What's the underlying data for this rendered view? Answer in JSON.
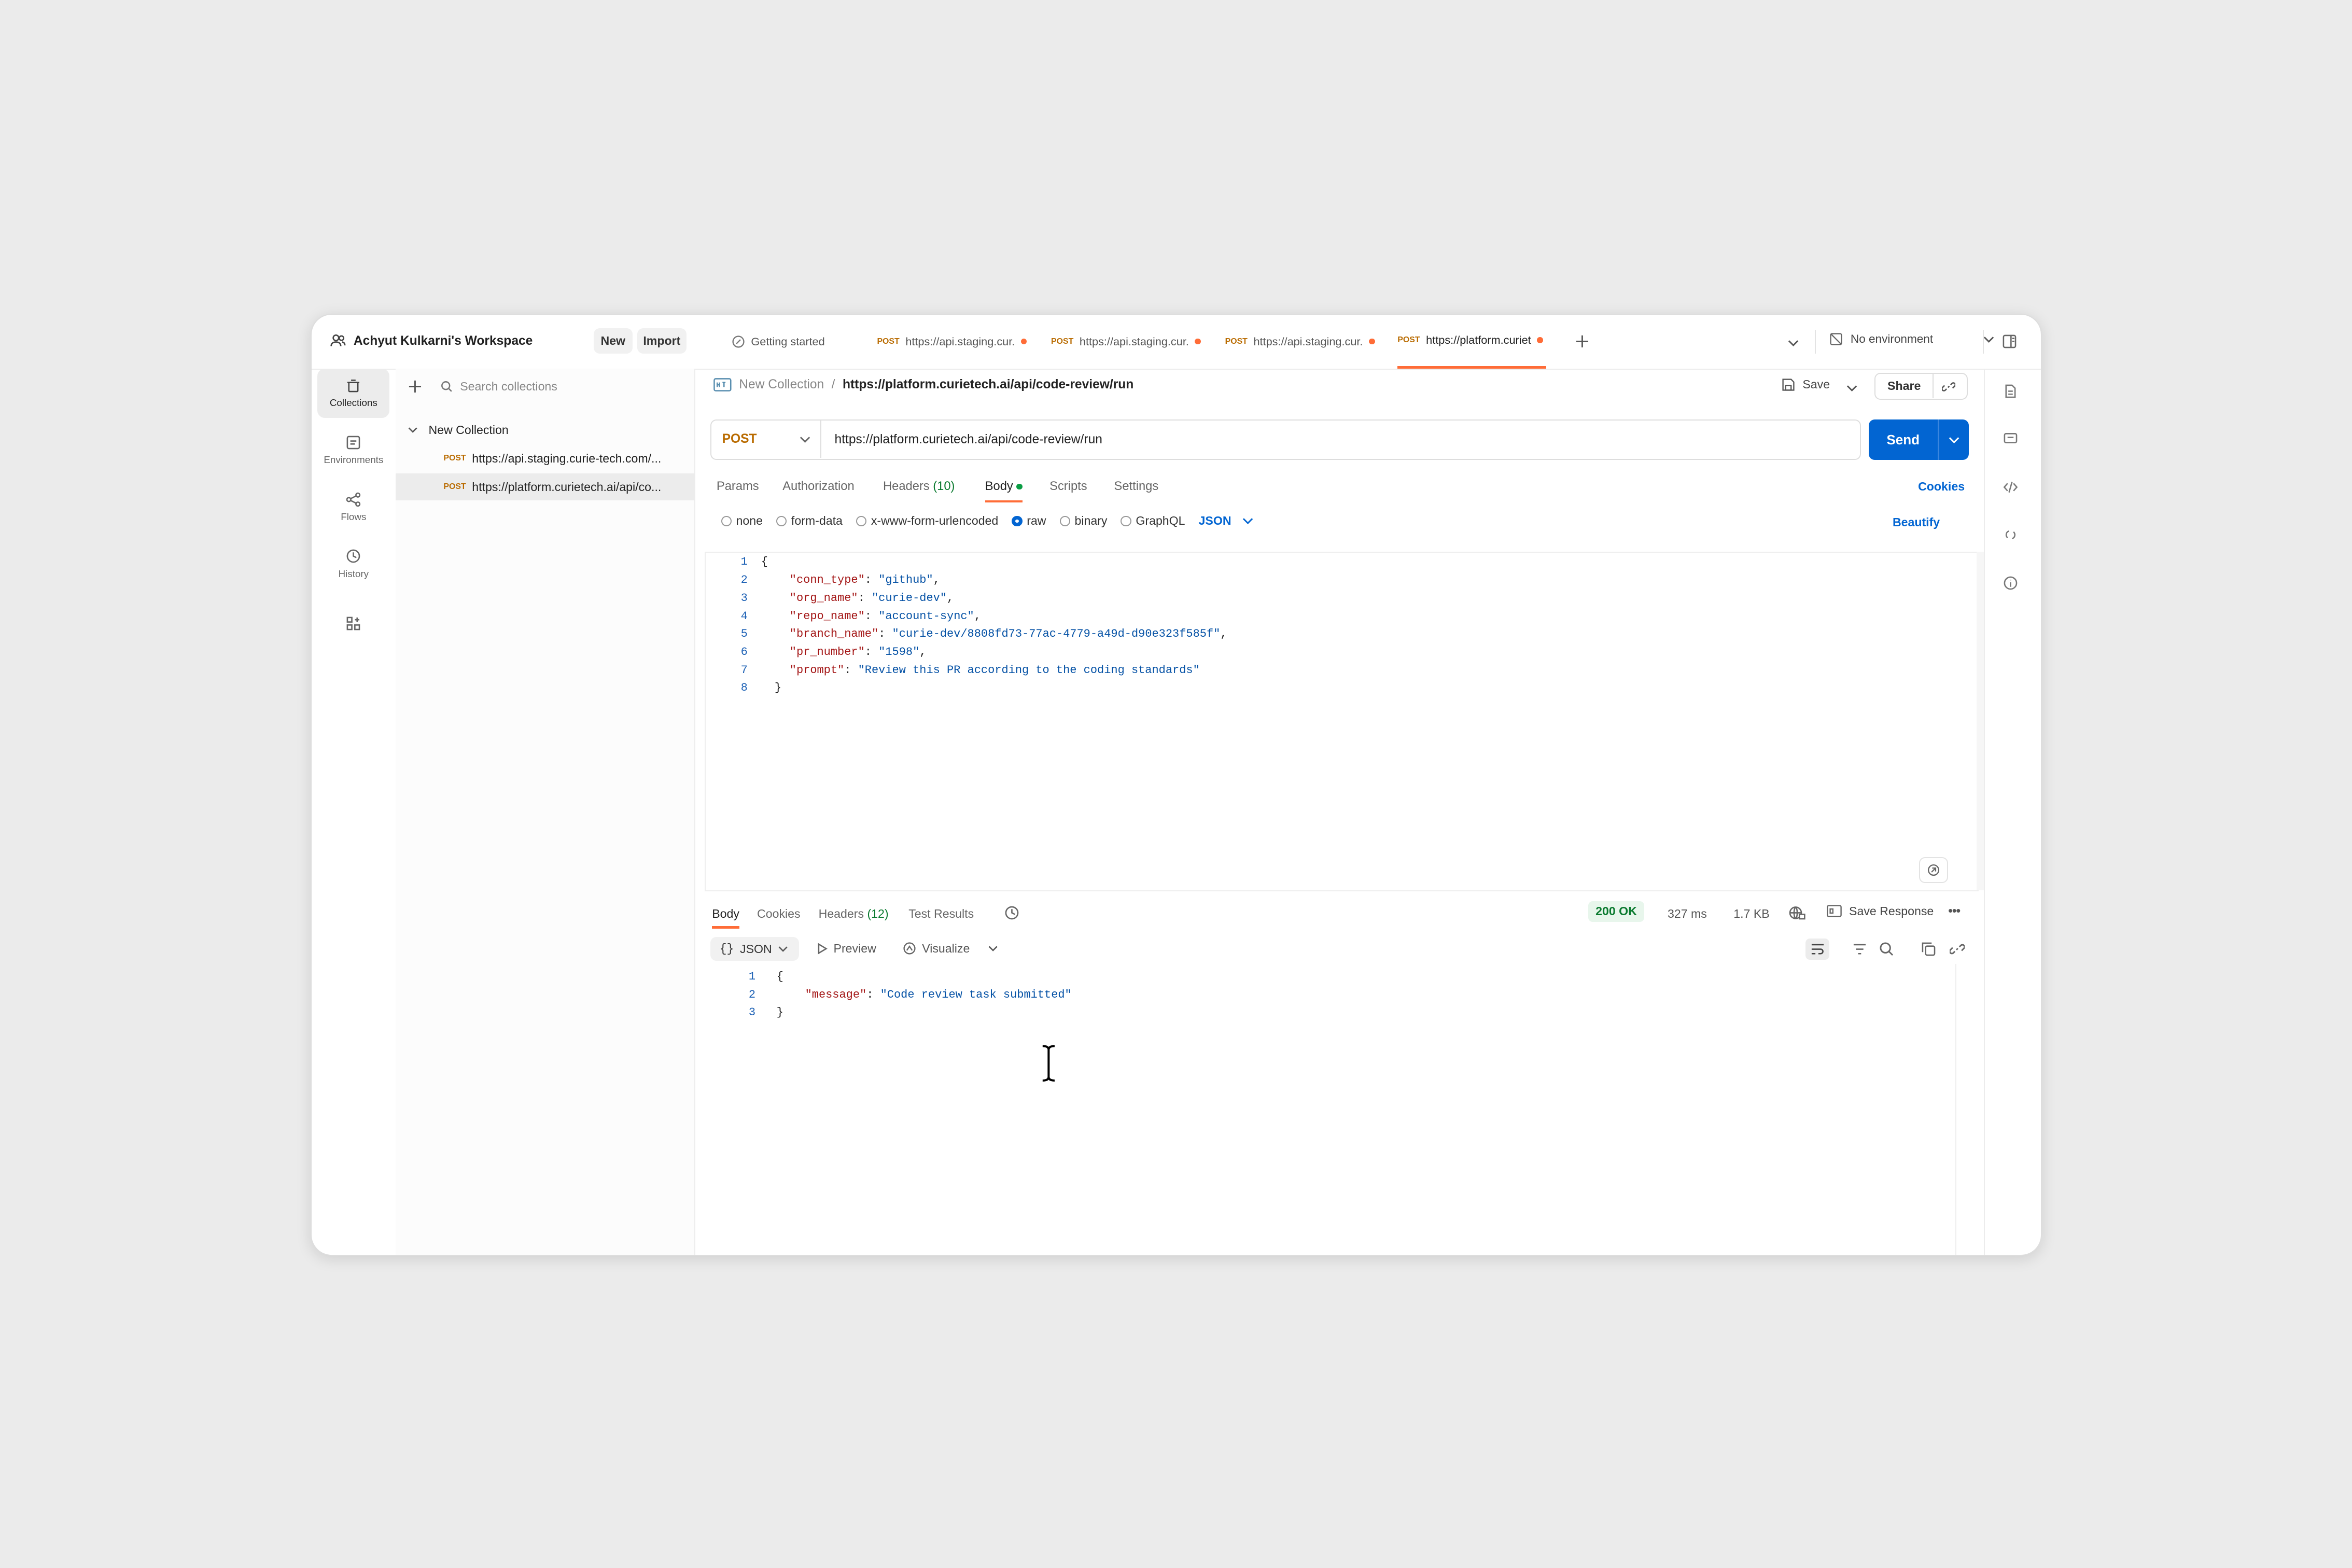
{
  "workspace": {
    "name": "Achyut Kulkarni's Workspace",
    "new_label": "New",
    "import_label": "Import"
  },
  "rail": [
    "Collections",
    "Environments",
    "Flows",
    "History"
  ],
  "collections": {
    "search_placeholder": "Search collections",
    "folder": "New Collection",
    "requests": [
      {
        "method": "POST",
        "url": "https://api.staging.curie-tech.com/..."
      },
      {
        "method": "POST",
        "url": "https://platform.curietech.ai/api/co..."
      }
    ]
  },
  "tabs": [
    {
      "method": "",
      "label": "Getting started"
    },
    {
      "method": "POST",
      "label": "https://api.staging.cur."
    },
    {
      "method": "POST",
      "label": "https://api.staging.cur."
    },
    {
      "method": "POST",
      "label": "https://api.staging.cur."
    },
    {
      "method": "POST",
      "label": "https://platform.curiet"
    }
  ],
  "environment": "No environment",
  "breadcrumb": {
    "collection": "New Collection",
    "sep": "/",
    "request": "https://platform.curietech.ai/api/code-review/run"
  },
  "actions": {
    "save": "Save",
    "share": "Share"
  },
  "request": {
    "method": "POST",
    "url": "https://platform.curietech.ai/api/code-review/run",
    "send": "Send",
    "tabs": [
      "Params",
      "Authorization",
      "Headers",
      "Body",
      "Scripts",
      "Settings"
    ],
    "headers_count": "(10)",
    "cookies": "Cookies",
    "body_modes": [
      "none",
      "form-data",
      "x-www-form-urlencoded",
      "raw",
      "binary",
      "GraphQL"
    ],
    "format": "JSON",
    "beautify": "Beautify"
  },
  "request_body": [
    {
      "n": "1",
      "text": "{"
    },
    {
      "n": "2",
      "key": "\"conn_type\"",
      "val": "\"github\"",
      "end": ","
    },
    {
      "n": "3",
      "key": "\"org_name\"",
      "val": "\"curie-dev\"",
      "end": ","
    },
    {
      "n": "4",
      "key": "\"repo_name\"",
      "val": "\"account-sync\"",
      "end": ","
    },
    {
      "n": "5",
      "key": "\"branch_name\"",
      "val": "\"curie-dev/8808fd73-77ac-4779-a49d-d90e323f585f\"",
      "end": ","
    },
    {
      "n": "6",
      "key": "\"pr_number\"",
      "val": "\"1598\"",
      "end": ","
    },
    {
      "n": "7",
      "key": "\"prompt\"",
      "val": "\"Review this PR according to the coding standards\"",
      "end": ""
    },
    {
      "n": "8",
      "text": "}"
    }
  ],
  "response": {
    "tabs": [
      "Body",
      "Cookies",
      "Headers",
      "Test Results"
    ],
    "headers_count": "(12)",
    "status": "200 OK",
    "time": "327 ms",
    "size": "1.7 KB",
    "save_response": "Save Response",
    "format": "JSON",
    "preview": "Preview",
    "visualize": "Visualize",
    "lines": [
      {
        "n": "1",
        "text": "{"
      },
      {
        "n": "2",
        "key": "\"message\"",
        "val": "\"Code review task submitted\""
      },
      {
        "n": "3",
        "text": "}"
      }
    ]
  }
}
